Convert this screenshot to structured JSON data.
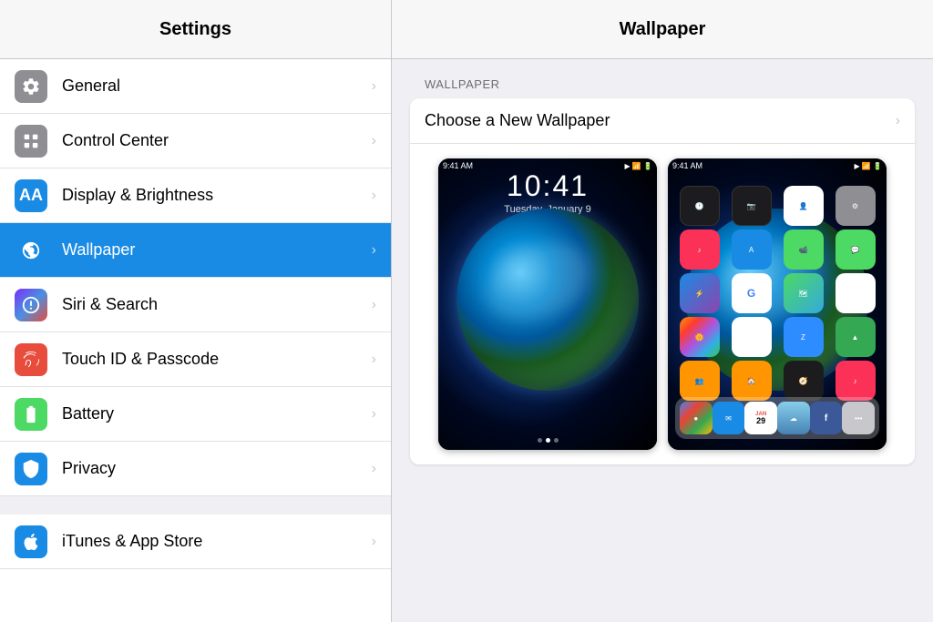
{
  "header": {
    "left_title": "Settings",
    "right_title": "Wallpaper"
  },
  "sidebar": {
    "items": [
      {
        "id": "general",
        "label": "General",
        "icon_color": "general",
        "icon_char": "⚙"
      },
      {
        "id": "control-center",
        "label": "Control Center",
        "icon_color": "control",
        "icon_char": "⊟"
      },
      {
        "id": "display",
        "label": "Display & Brightness",
        "icon_color": "display",
        "icon_char": "A"
      },
      {
        "id": "wallpaper",
        "label": "Wallpaper",
        "icon_color": "wallpaper",
        "icon_char": "✿",
        "active": true
      },
      {
        "id": "siri",
        "label": "Siri & Search",
        "icon_color": "siri",
        "icon_char": "◎"
      },
      {
        "id": "touchid",
        "label": "Touch ID & Passcode",
        "icon_color": "touchid",
        "icon_char": "◉"
      },
      {
        "id": "battery",
        "label": "Battery",
        "icon_color": "battery",
        "icon_char": "▬"
      },
      {
        "id": "privacy",
        "label": "Privacy",
        "icon_color": "privacy",
        "icon_char": "✋"
      },
      {
        "id": "appstore",
        "label": "iTunes & App Store",
        "icon_color": "appstore",
        "icon_char": "A"
      }
    ]
  },
  "wallpaper_panel": {
    "section_label": "WALLPAPER",
    "choose_label": "Choose a New Wallpaper",
    "lock_screen_time": "10:41",
    "lock_screen_date": "Tuesday, January 9",
    "home_dot_label": "●"
  }
}
